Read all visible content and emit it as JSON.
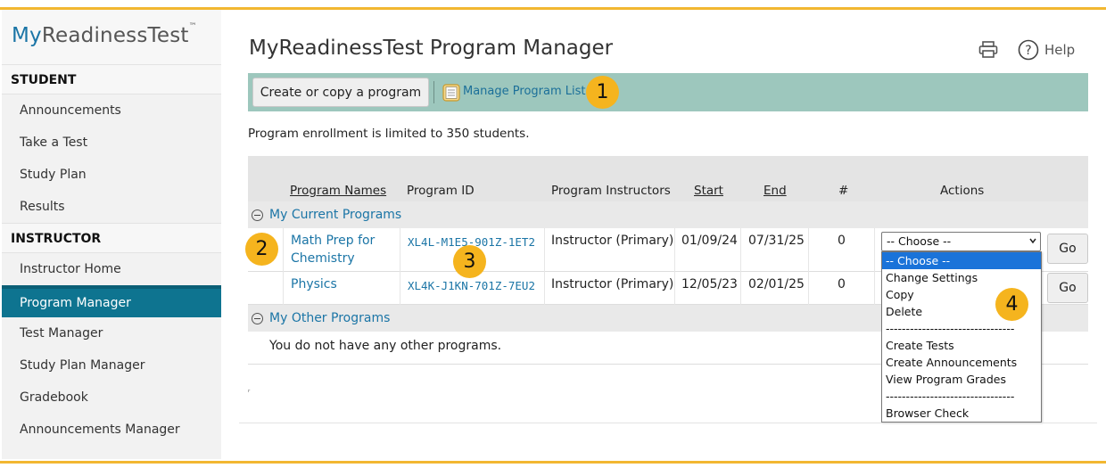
{
  "brand": {
    "my": "My",
    "rest": "ReadinessTest",
    "tm": "™"
  },
  "sidebar": {
    "student_heading": "STUDENT",
    "student_items": [
      {
        "label": "Announcements"
      },
      {
        "label": "Take a Test"
      },
      {
        "label": "Study Plan"
      },
      {
        "label": "Results"
      }
    ],
    "instructor_heading": "INSTRUCTOR",
    "instructor_items": [
      {
        "label": "Instructor Home"
      },
      {
        "label": "Program Manager",
        "active": true
      },
      {
        "label": "Test Manager"
      },
      {
        "label": "Study Plan Manager"
      },
      {
        "label": "Gradebook"
      },
      {
        "label": "Announcements Manager"
      }
    ]
  },
  "header": {
    "title": "MyReadinessTest Program Manager",
    "help_label": "Help"
  },
  "toolbar": {
    "create_label": "Create or copy a program",
    "manage_label": "Manage Program List"
  },
  "enrollment_note": "Program enrollment is limited to 350 students.",
  "table": {
    "columns": {
      "names": "Program Names",
      "id": "Program ID",
      "instructors": "Program Instructors",
      "start": "Start",
      "end": "End",
      "count": "#",
      "actions": "Actions"
    },
    "current_group": "My Current Programs",
    "rows": [
      {
        "name_line1": "Math Prep for",
        "name_line2": "Chemistry",
        "id": "XL4L-M1E5-901Z-1ET2",
        "instructor": "Instructor (Primary)",
        "start": "01/09/24",
        "end": "07/31/25",
        "count": "0",
        "select_value": "-- Choose --",
        "go_label": "Go"
      },
      {
        "name": "Physics",
        "id": "XL4K-J1KN-701Z-7EU2",
        "instructor": "Instructor (Primary)",
        "start": "12/05/23",
        "end": "02/01/25",
        "count": "0",
        "go_label": "Go"
      }
    ],
    "other_group": "My Other Programs",
    "other_empty": "You do not have any other programs."
  },
  "dropdown": {
    "options": [
      "-- Choose --",
      "Change Settings",
      "Copy",
      "Delete",
      "--------------------------------",
      "Create Tests",
      "Create Announcements",
      "View Program Grades",
      "--------------------------------",
      "Browser Check"
    ],
    "selected_index": 0
  },
  "callouts": [
    "1",
    "2",
    "3",
    "4"
  ],
  "stray_mark": "ʳ",
  "colors": {
    "accent": "#f2b731",
    "toolbar": "#9dc7bd",
    "active_nav": "#0e7490",
    "link": "#1b75a6",
    "callout": "#f5b41e"
  }
}
